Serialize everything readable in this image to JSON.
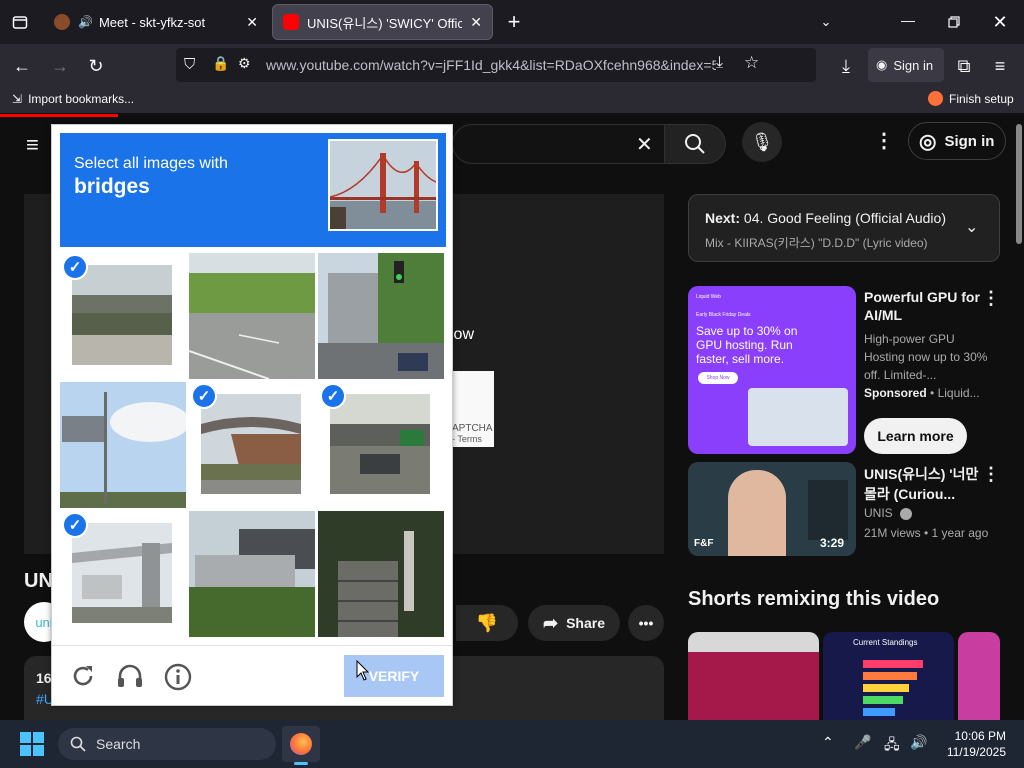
{
  "tabs": [
    {
      "title": "Meet - skt-yfkz-sot",
      "active": false
    },
    {
      "title": "UNIS(유니스) 'SWICY' Official M",
      "active": true
    }
  ],
  "address": "www.youtube.com/watch?v=jFF1Id_gkk4&list=RDaOXfcehn968&index=5",
  "browser": {
    "sign_in": "Sign in",
    "import_bookmarks": "Import bookmarks...",
    "finish_setup": "Finish setup"
  },
  "youtube": {
    "sign_in": "Sign in",
    "up_next_prefix": "Next:",
    "up_next_title": "04. Good Feeling (Official Audio)",
    "up_next_sub": "Mix - KIIRAS(키라스) \"D.D.D\" (Lyric video)",
    "ad": {
      "title": "Powerful GPU for AI/ML",
      "desc": "High-power GPU Hosting now up to 30% off. Limited-...",
      "sponsored": "Sponsored",
      "advertiser": "Liquid...",
      "cta": "Learn more",
      "thumb_small": "Liquid Web",
      "thumb_mid": "Early Black Friday Deals",
      "thumb_big": "Save up to 30% on GPU hosting. Run faster, sell more.",
      "thumb_btn": "Shop Now"
    },
    "rec": {
      "title": "UNIS(유니스) '너만 몰라 (Curiou...",
      "channel": "UNIS",
      "meta": "21M views • 1 year ago",
      "duration": "3:29",
      "badge": "F&F"
    },
    "shorts_heading": "Shorts remixing this video",
    "short_chart_title": "Current Standings",
    "video_title_partial": "UN",
    "channel_partial": "uni",
    "desc_partial": "16",
    "desc_tag": "#U",
    "share": "Share",
    "behind_text": "low",
    "recaptcha_text": "APTCHA",
    "recaptcha_terms": "- Terms"
  },
  "captcha": {
    "prompt": "Select all images with",
    "target": "bridges",
    "verify": "VERIFY",
    "tiles": [
      {
        "scene": "overpass-close",
        "selected": true
      },
      {
        "scene": "highway-grass",
        "selected": false
      },
      {
        "scene": "street-traffic-light",
        "selected": false
      },
      {
        "scene": "billboard-sky",
        "selected": false
      },
      {
        "scene": "overpass-dirt",
        "selected": true
      },
      {
        "scene": "overpass-road-sign",
        "selected": true
      },
      {
        "scene": "elevated-highway",
        "selected": true
      },
      {
        "scene": "building-trees",
        "selected": false
      },
      {
        "scene": "stairs-garden",
        "selected": false
      }
    ]
  },
  "taskbar": {
    "search": "Search",
    "time": "10:06 PM",
    "date": "11/19/2025"
  },
  "colors": {
    "captcha_blue": "#1a73e8",
    "yt_bg": "#0f0f0f",
    "ad_purple": "#8a3ffc"
  }
}
